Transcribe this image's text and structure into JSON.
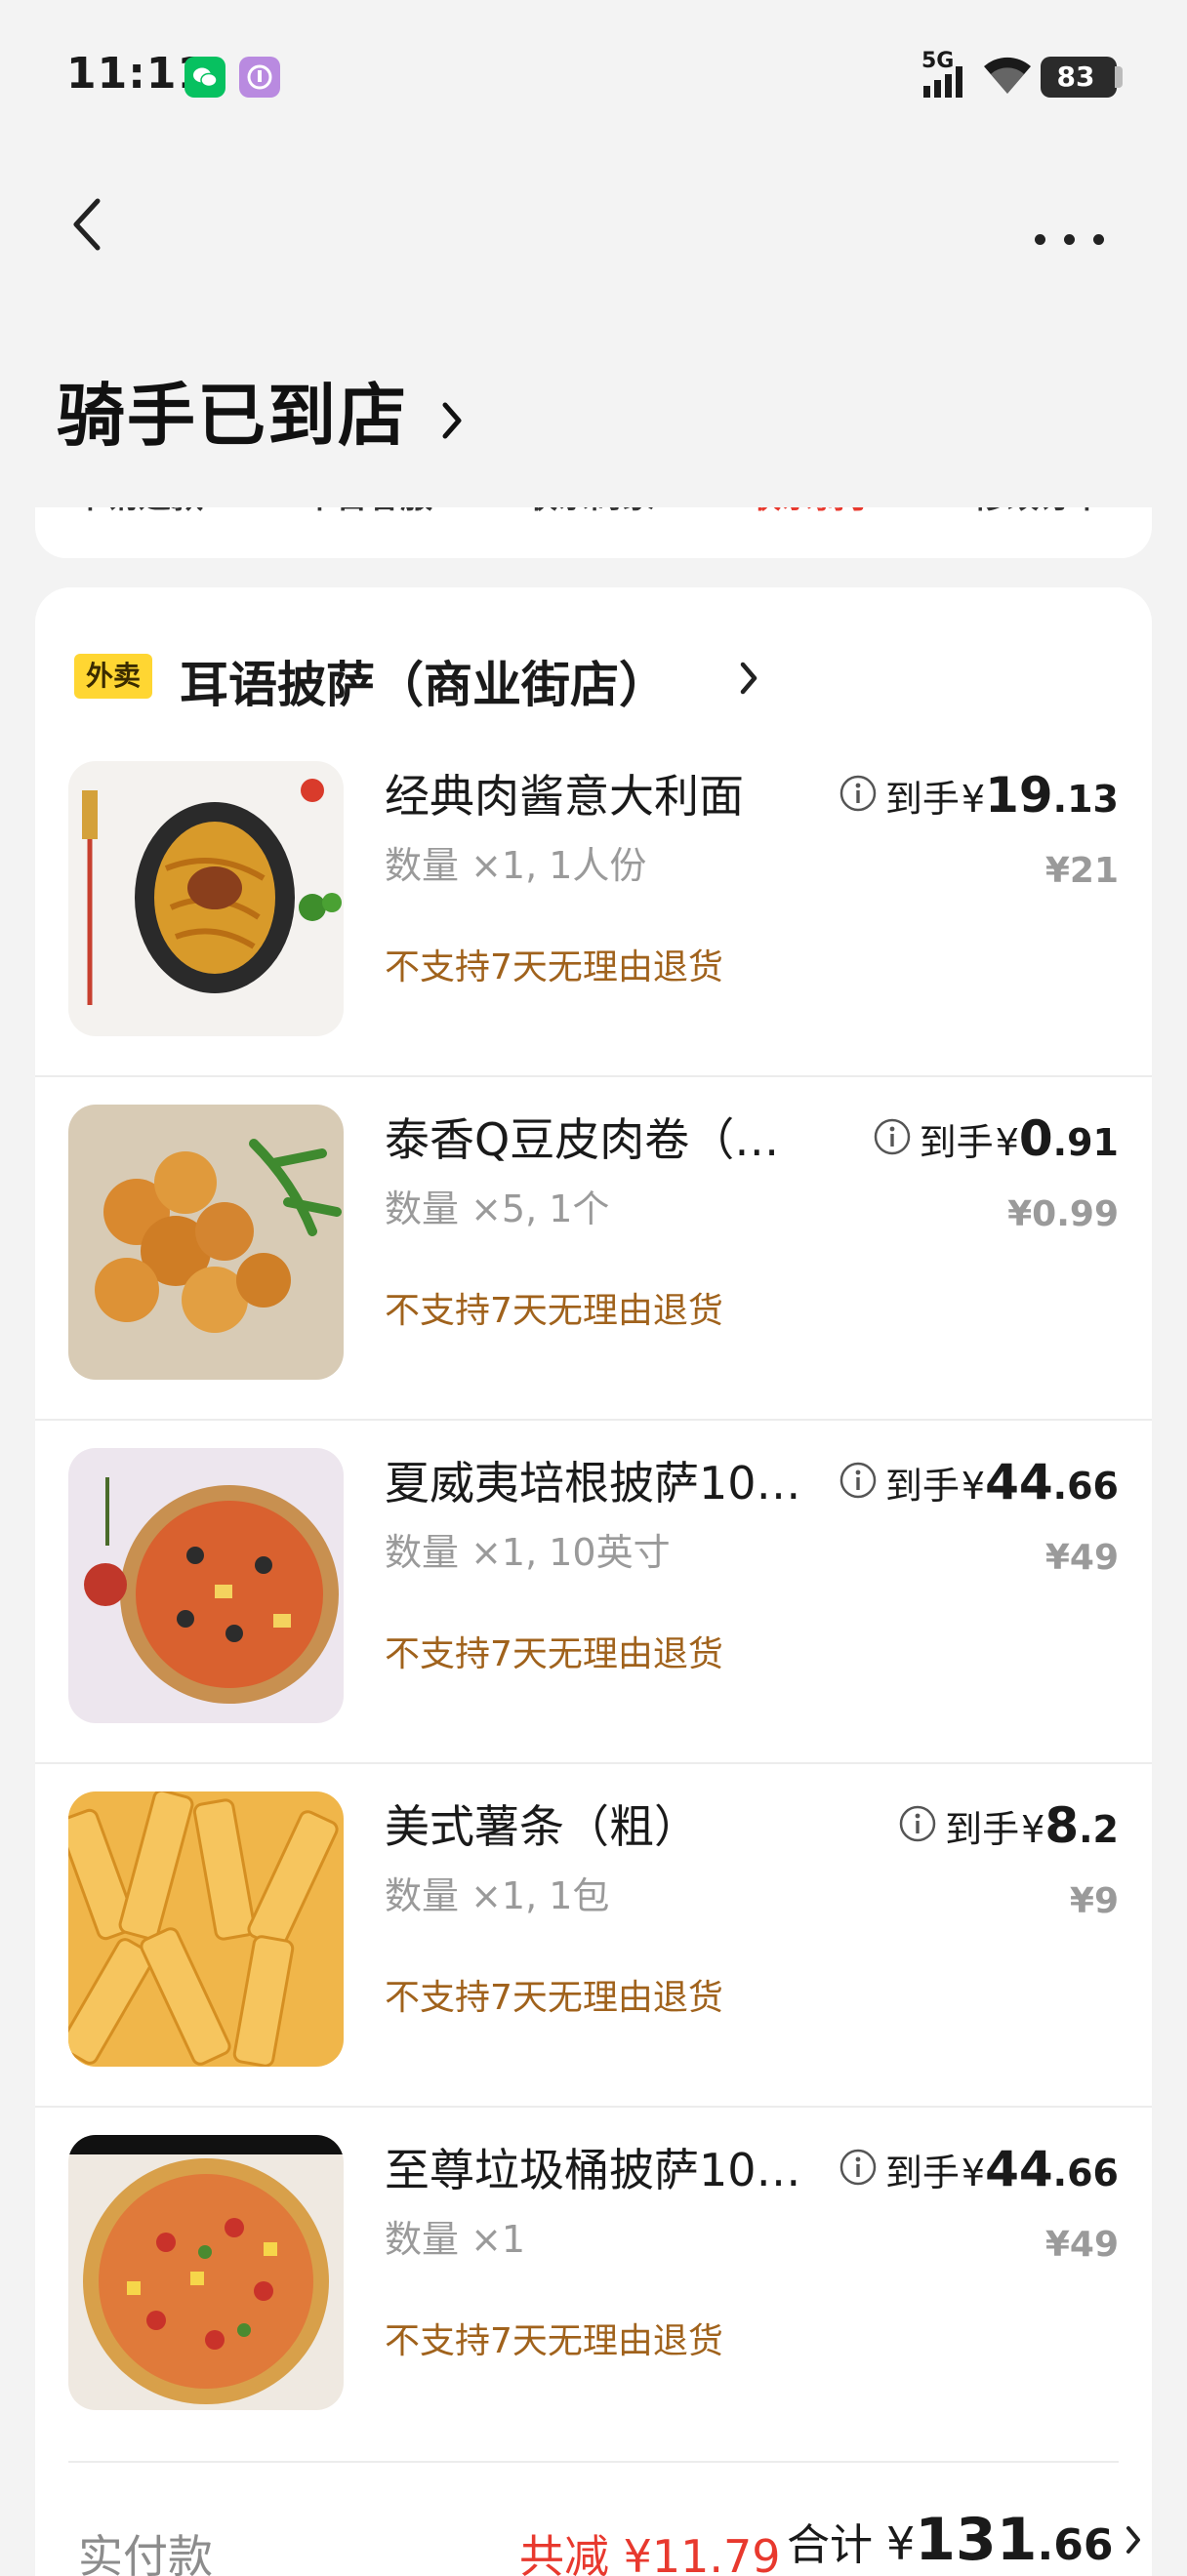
{
  "status_bar": {
    "time": "11:11",
    "network": "5G",
    "battery": "83"
  },
  "header": {
    "title": "骑手已到店"
  },
  "actions": [
    {
      "label": "申请退款",
      "highlight": false
    },
    {
      "label": "平台客服",
      "highlight": false
    },
    {
      "label": "联系商家",
      "highlight": false
    },
    {
      "label": "联系骑手",
      "highlight": true
    },
    {
      "label": "修改订单",
      "highlight": false
    }
  ],
  "shop": {
    "tag": "外卖",
    "name": "耳语披萨（商业街店）"
  },
  "items": [
    {
      "name": "经典肉酱意大利面",
      "qty": "数量 ×1, 1人份",
      "policy": "不支持7天无理由退货",
      "price_label": "到手",
      "price_yen": "¥",
      "price_int": "19",
      "price_dec": ".13",
      "orig_price": "¥21",
      "image": "spaghetti-image"
    },
    {
      "name": "泰香Q豆皮肉卷（…",
      "qty": "数量 ×5, 1个",
      "policy": "不支持7天无理由退货",
      "price_label": "到手",
      "price_yen": "¥",
      "price_int": "0",
      "price_dec": ".91",
      "orig_price": "¥0.99",
      "image": "tofu-roll-image"
    },
    {
      "name": "夏威夷培根披萨10…",
      "qty": "数量 ×1, 10英寸",
      "policy": "不支持7天无理由退货",
      "price_label": "到手",
      "price_yen": "¥",
      "price_int": "44",
      "price_dec": ".66",
      "orig_price": "¥49",
      "image": "hawaiian-pizza-image"
    },
    {
      "name": "美式薯条（粗）",
      "qty": "数量 ×1, 1包",
      "policy": "不支持7天无理由退货",
      "price_label": "到手",
      "price_yen": "¥",
      "price_int": "8",
      "price_dec": ".2",
      "orig_price": "¥9",
      "image": "fries-image"
    },
    {
      "name": "至尊垃圾桶披萨10…",
      "qty": "数量 ×1",
      "policy": "不支持7天无理由退货",
      "price_label": "到手",
      "price_yen": "¥",
      "price_int": "44",
      "price_dec": ".66",
      "orig_price": "¥49",
      "image": "supreme-pizza-image"
    }
  ],
  "summary": {
    "paid_label": "实付款",
    "discount": "共减 ¥11.79",
    "total_label": "合计",
    "total_yen": "¥",
    "total_int": "131",
    "total_dec": ".66"
  },
  "colors": {
    "accent_red": "#e8392e",
    "policy_brown": "#a0621c",
    "tag_yellow": "#ffd632"
  }
}
